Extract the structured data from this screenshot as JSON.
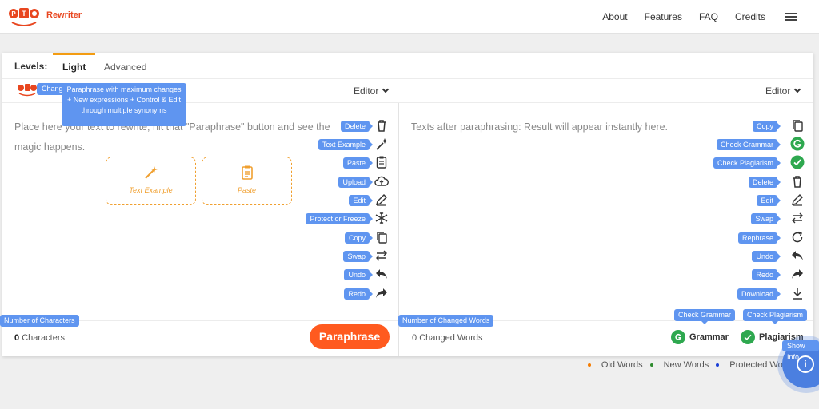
{
  "header": {
    "brand": "Rewriter",
    "logo_text": "PTO",
    "nav": [
      "About",
      "Features",
      "FAQ",
      "Credits"
    ]
  },
  "levels": {
    "label": "Levels:",
    "tabs": [
      "Light",
      "Advanced"
    ],
    "active_tab": "Light"
  },
  "tooltips": {
    "change_chip": "Chang",
    "light_description": "Paraphrase with maximum changes + New expressions + Control & Edit through multiple synonyms"
  },
  "editor_left": {
    "dropdown": "Editor",
    "placeholder": "Place here your text to rewrite, hit that \"Paraphrase\" button and see the magic happens.",
    "quick_actions": [
      "Text Example",
      "Paste"
    ],
    "tools": [
      "Delete",
      "Text Example",
      "Paste",
      "Upload",
      "Edit",
      "Protect or Freeze",
      "Copy",
      "Swap",
      "Undo",
      "Redo"
    ],
    "counter_label": "Number of Characters",
    "counter_value": "0",
    "counter_unit": "Characters",
    "paraphrase_button": "Paraphrase"
  },
  "editor_right": {
    "dropdown": "Editor",
    "placeholder": "Texts after paraphrasing: Result will appear instantly here.",
    "tools": [
      "Copy",
      "Check Grammar",
      "Check Plagiarism",
      "Delete",
      "Edit",
      "Swap",
      "Rephrase",
      "Undo",
      "Redo",
      "Download"
    ],
    "counter_label": "Number of Changed Words",
    "counter_value": "0",
    "counter_unit": "Changed Words",
    "grammar_chip": "Check Grammar",
    "plagiarism_chip": "Check Plagiarism",
    "grammar_label": "Grammar",
    "plagiarism_label": "Plagiarism"
  },
  "legend": [
    {
      "label": "Old Words",
      "color": "#f57c00"
    },
    {
      "label": "New Words",
      "color": "#2e8b2e"
    },
    {
      "label": "Protected Words",
      "color": "#1a3fd6"
    }
  ],
  "show_info": "Show Info",
  "colors": {
    "accent": "#ff5a1f",
    "tooltip": "#5f95f0",
    "active_tab": "#f39c12",
    "grammar": "#2ea84f"
  }
}
